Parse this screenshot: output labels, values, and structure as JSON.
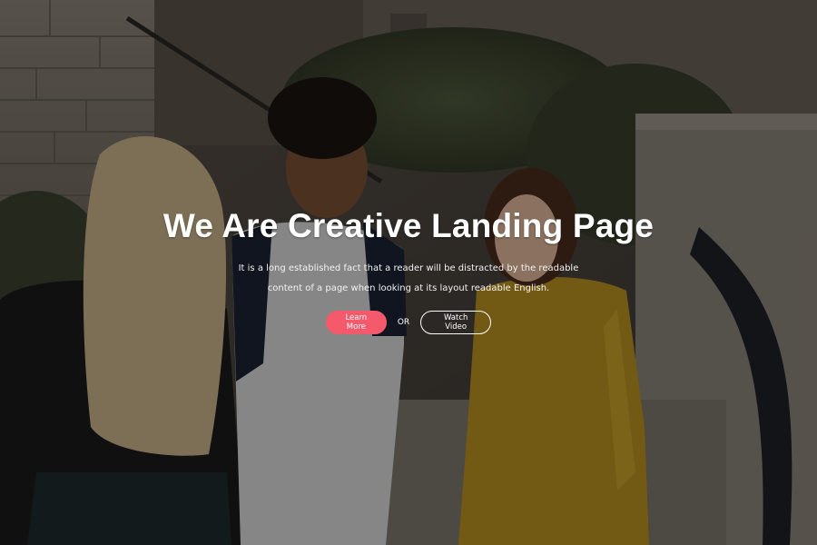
{
  "hero": {
    "title": "We Are Creative Landing Page",
    "description_line1": "It is a long established fact that a reader will be distracted by the readable",
    "description_line2": "content of a page when looking at its layout readable English.",
    "primary_button_label": "Learn More",
    "separator": "OR",
    "secondary_button_label": "Watch Video"
  },
  "colors": {
    "accent": "#f45a6b",
    "text": "#ffffff",
    "overlay": "rgba(0,0,0,0.38)"
  }
}
